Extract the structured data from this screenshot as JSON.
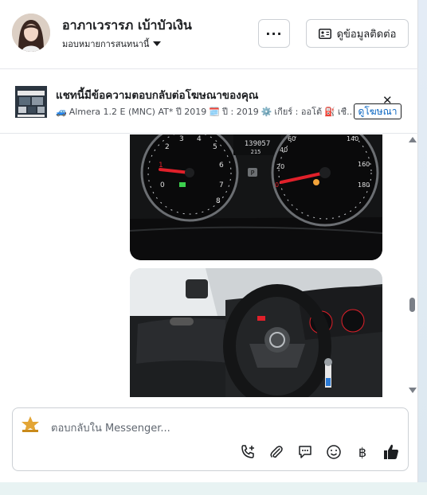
{
  "header": {
    "user_name": "อาภาเวรารภ เบ้าบัวเงิน",
    "assign_label": "มอบหมายการสนทนานี้",
    "more_label": "···",
    "contact_label": "ดูข้อมูลติดต่อ"
  },
  "ad": {
    "title": "แชทนี้มีข้อความตอบกลับต่อโฆษณาของคุณ",
    "car_emoji": "🚙",
    "model_text": "Almera 1.2 E (MNC) AT* ปี 2019",
    "calendar_emoji": "🗓️",
    "year_text": "ปี : 2019",
    "gear_emoji": "⚙️",
    "gear_text": "เกียร์ : ออโต้",
    "fuel_emoji": "⛽",
    "fuel_text": "เชื...",
    "link_label": "ดูโฆษณา",
    "close_label": "✕"
  },
  "dashboard": {
    "odometer": "139057"
  },
  "composer": {
    "placeholder": "ตอบกลับใน Messenger...",
    "baht_symbol": "฿"
  },
  "colors": {
    "link": "#0a66c2",
    "gauge_red": "#e0202a"
  }
}
